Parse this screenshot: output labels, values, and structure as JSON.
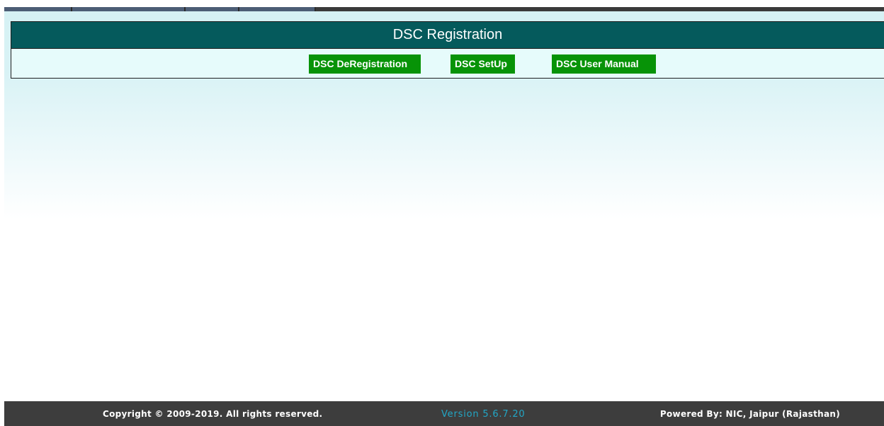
{
  "panel": {
    "title": "DSC Registration",
    "buttons": {
      "deregistration": "DSC DeRegistration",
      "setup": "DSC SetUp",
      "user_manual": "DSC User Manual"
    }
  },
  "footer": {
    "copyright": "Copyright © 2009-2019. All rights reserved.",
    "version": "Version 5.6.7.20",
    "powered_by": "Powered By: NIC, Jaipur (Rajasthan)"
  },
  "colors": {
    "header_bg": "#055a5c",
    "button_bg": "#079307",
    "footer_bg": "#3d3d3d",
    "version_text": "#22a7c6"
  }
}
